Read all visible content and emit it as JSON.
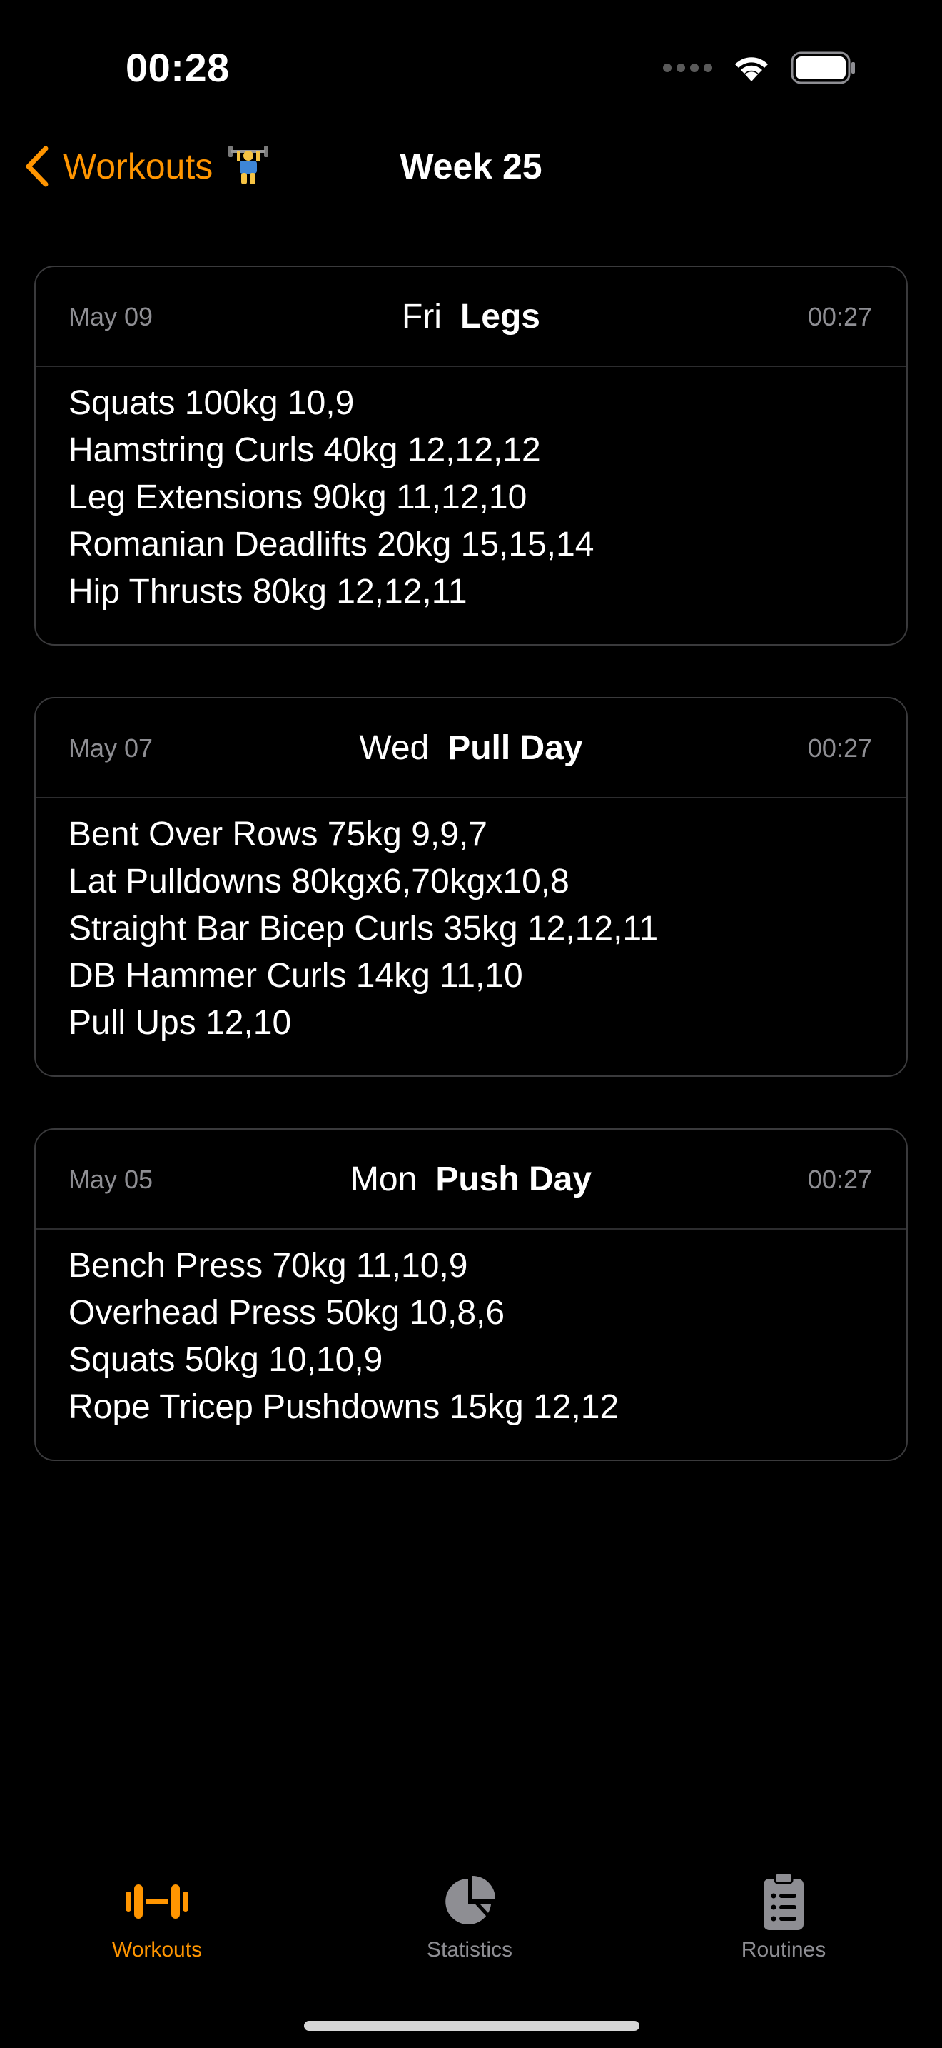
{
  "status_bar": {
    "time": "00:28"
  },
  "nav": {
    "back_label": "Workouts",
    "emoji": "🏋️",
    "title": "Week 25"
  },
  "workouts": [
    {
      "date": "May 09",
      "day": "Fri",
      "name": "Legs",
      "time": "00:27",
      "exercises": [
        "Squats 100kg 10,9",
        "Hamstring Curls 40kg 12,12,12",
        "Leg Extensions 90kg 11,12,10",
        "Romanian Deadlifts 20kg 15,15,14",
        "Hip Thrusts 80kg 12,12,11"
      ]
    },
    {
      "date": "May 07",
      "day": "Wed",
      "name": "Pull Day",
      "time": "00:27",
      "exercises": [
        "Bent Over Rows 75kg 9,9,7",
        "Lat Pulldowns 80kgx6,70kgx10,8",
        "Straight Bar Bicep Curls 35kg 12,12,11",
        "DB Hammer Curls 14kg 11,10",
        "Pull Ups 12,10"
      ]
    },
    {
      "date": "May 05",
      "day": "Mon",
      "name": "Push Day",
      "time": "00:27",
      "exercises": [
        "Bench Press 70kg 11,10,9",
        "Overhead Press 50kg 10,8,6",
        "Squats 50kg 10,10,9",
        "Rope Tricep Pushdowns 15kg 12,12"
      ]
    }
  ],
  "tabs": [
    {
      "label": "Workouts",
      "icon": "dumbbell-icon",
      "active": true
    },
    {
      "label": "Statistics",
      "icon": "pie-chart-icon",
      "active": false
    },
    {
      "label": "Routines",
      "icon": "clipboard-list-icon",
      "active": false
    }
  ],
  "colors": {
    "accent": "#ff9500",
    "inactive": "#8e8e93",
    "card_border": "#3a3a3c",
    "background": "#000000"
  }
}
